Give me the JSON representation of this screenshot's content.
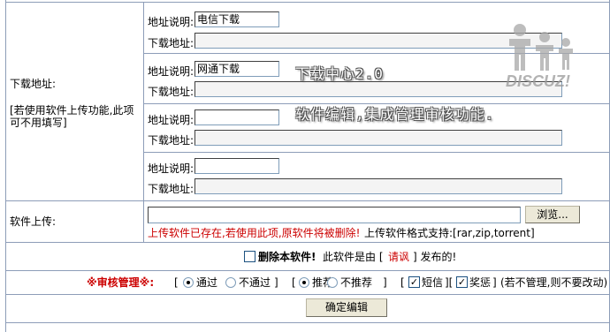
{
  "download": {
    "label": "下载地址:",
    "hint": "[若使用软件上传功能,此项可不用填写]",
    "desc_label": "地址说明:",
    "addr_label": "下载地址:",
    "entries": [
      {
        "desc": "电信下载",
        "addr": ""
      },
      {
        "desc": "网通下载",
        "addr": ""
      },
      {
        "desc": "",
        "addr": ""
      },
      {
        "desc": "",
        "addr": ""
      }
    ]
  },
  "upload": {
    "label": "软件上传:",
    "file_value": "",
    "browse_label": "浏览...",
    "warning": "上传软件已存在,若使用此项,原软件将被删除!",
    "formats": "上传软件格式支持:[rar,zip,torrent]"
  },
  "delete": {
    "checked": false,
    "label": "删除本软件!",
    "text_pre": "此软件是由 [",
    "uploader": "请讽",
    "text_post": "] 发布的!"
  },
  "review": {
    "label": "※审核管理※:",
    "approve_label": "通过",
    "reject_label": "不通过",
    "approve_selected": true,
    "recommend_label": "推荐",
    "no_recommend_label": "不推荐",
    "recommend_selected": true,
    "sms_label": "短信",
    "sms_checked": true,
    "reward_label": "奖惩",
    "reward_checked": true,
    "note": "(若不管理,则不要改动)"
  },
  "submit_label": "确定编辑",
  "overlay": {
    "line1": "下载中心2.0",
    "line2": "软件编辑,集成管理审核功能."
  },
  "logo": {
    "text": "DISCUZ!",
    "color": "#9a9a9a"
  }
}
